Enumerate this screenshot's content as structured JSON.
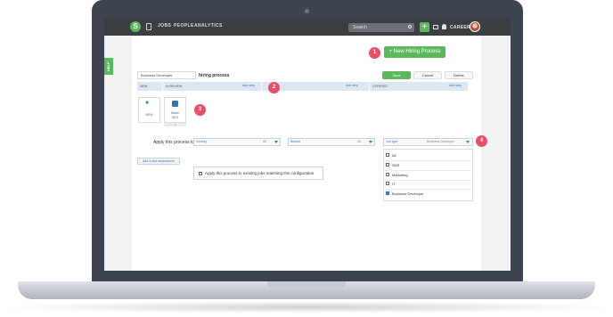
{
  "nav": {
    "logo": "S",
    "links": [
      "JOBS",
      "PEOPLE",
      "ANALYTICS"
    ],
    "search_placeholder": "Search",
    "plus": "+",
    "careers": "CAREERS"
  },
  "help": "HELP",
  "new_process_button": "+ New Hiring Process",
  "callouts": [
    "1",
    "2",
    "3",
    "4"
  ],
  "process": {
    "name": "Business Developer",
    "label": "hiring process",
    "save": "Save",
    "cancel": "Cancel",
    "delete": "Delete"
  },
  "columns": [
    {
      "label": "NEW",
      "add_step": ""
    },
    {
      "label": "IN REVIEW",
      "add_step": "Add step"
    },
    {
      "label": "",
      "add_step": "Add step"
    },
    {
      "label": "OFFERED",
      "add_step": "Add step"
    }
  ],
  "cards": [
    {
      "label": "NEW"
    },
    {
      "label": "Match",
      "sublabel": "SEO"
    }
  ],
  "card_footer": "x",
  "apply": {
    "label": "Apply this process to",
    "dropdowns": [
      {
        "label": "Country",
        "value": "All"
      },
      {
        "label": "Brands",
        "value": "All"
      },
      {
        "label": "Job type",
        "value": "Business Developer"
      }
    ],
    "job_type_options": [
      {
        "label": "All",
        "checked": false
      },
      {
        "label": "SDR",
        "checked": false
      },
      {
        "label": "Marketing",
        "checked": false
      },
      {
        "label": "IT",
        "checked": false
      },
      {
        "label": "Business Developer",
        "checked": true
      }
    ]
  },
  "add_assessment": "Add in-line assessment",
  "existing_jobs": "Apply this process to existing jobs matching this configuration",
  "colors": {
    "accent": "#5cb85c",
    "callout": "#e5506a",
    "link": "#3d7ab8",
    "nav": "#3b3f44"
  }
}
